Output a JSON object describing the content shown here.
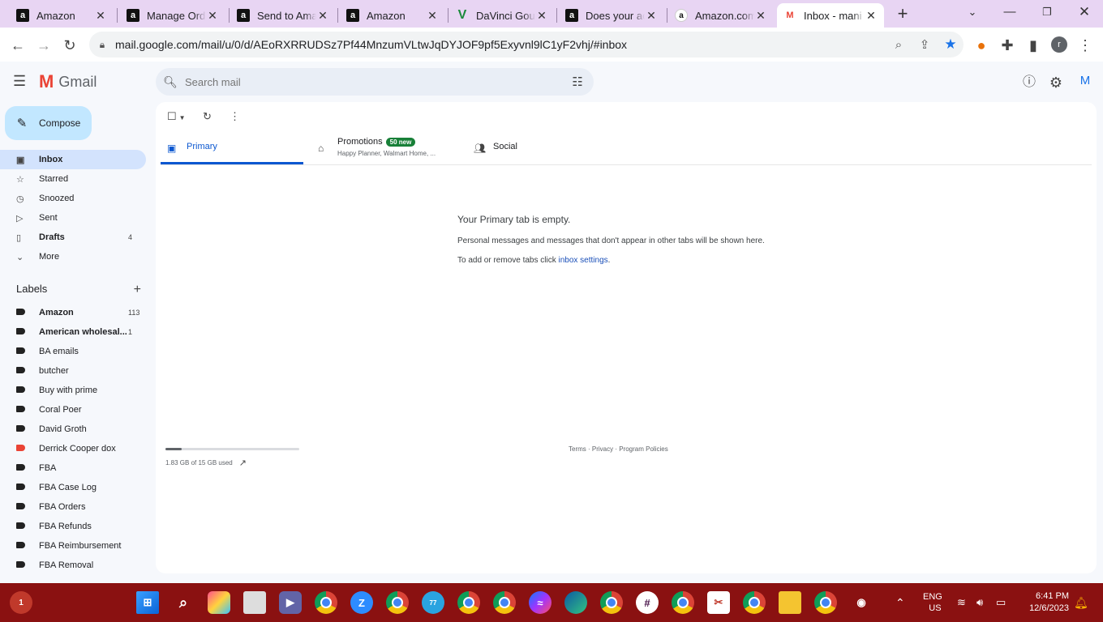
{
  "browser": {
    "tabs": [
      {
        "title": "Amazon",
        "favicon": "amazon-a-icon",
        "active": false
      },
      {
        "title": "Manage Orders",
        "favicon": "amazon-a-icon",
        "active": false
      },
      {
        "title": "Send to Amazon",
        "favicon": "amazon-a-icon",
        "active": false
      },
      {
        "title": "Amazon",
        "favicon": "amazon-a-icon",
        "active": false
      },
      {
        "title": "DaVinci Gourmet",
        "favicon": "davinci-icon",
        "active": false
      },
      {
        "title": "Does your ac",
        "favicon": "amazon-a-icon",
        "active": false
      },
      {
        "title": "Amazon.com",
        "favicon": "amazon-smile-icon",
        "active": false
      },
      {
        "title": "Inbox - mani",
        "favicon": "gmail-icon",
        "active": true
      }
    ],
    "url": "mail.google.com/mail/u/0/d/AEoRXRRUDSz7Pf44MnzumVLtwJqDYJOF9pf5Exyvnl9lC1yF2vhj/#inbox",
    "profile_initial": "r"
  },
  "gmail": {
    "brand": "Gmail",
    "search_placeholder": "Search mail",
    "account_initial": "M",
    "compose_label": "Compose",
    "nav": [
      {
        "label": "Inbox",
        "icon": "inbox-icon",
        "count": "",
        "active": true,
        "bold": true
      },
      {
        "label": "Starred",
        "icon": "star-icon",
        "count": "",
        "active": false,
        "bold": false
      },
      {
        "label": "Snoozed",
        "icon": "clock-icon",
        "count": "",
        "active": false,
        "bold": false
      },
      {
        "label": "Sent",
        "icon": "send-icon",
        "count": "",
        "active": false,
        "bold": false
      },
      {
        "label": "Drafts",
        "icon": "draft-icon",
        "count": "4",
        "active": false,
        "bold": true
      },
      {
        "label": "More",
        "icon": "chevron-down-icon",
        "count": "",
        "active": false,
        "bold": false
      }
    ],
    "labels_title": "Labels",
    "labels": [
      {
        "name": "Amazon",
        "count": "113",
        "bold": true,
        "color": "#202124"
      },
      {
        "name": "American wholesal...",
        "count": "1",
        "bold": true,
        "color": "#202124"
      },
      {
        "name": "BA emails",
        "count": "",
        "bold": false,
        "color": "#202124"
      },
      {
        "name": "butcher",
        "count": "",
        "bold": false,
        "color": "#202124"
      },
      {
        "name": "Buy with prime",
        "count": "",
        "bold": false,
        "color": "#202124"
      },
      {
        "name": "Coral Poer",
        "count": "",
        "bold": false,
        "color": "#202124"
      },
      {
        "name": "David Groth",
        "count": "",
        "bold": false,
        "color": "#202124"
      },
      {
        "name": "Derrick Cooper dox",
        "count": "",
        "bold": false,
        "color": "#ea4335"
      },
      {
        "name": "FBA",
        "count": "",
        "bold": false,
        "color": "#202124"
      },
      {
        "name": "FBA Case Log",
        "count": "",
        "bold": false,
        "color": "#202124"
      },
      {
        "name": "FBA Orders",
        "count": "",
        "bold": false,
        "color": "#202124"
      },
      {
        "name": "FBA Refunds",
        "count": "",
        "bold": false,
        "color": "#202124"
      },
      {
        "name": "FBA Reimbursement",
        "count": "",
        "bold": false,
        "color": "#202124"
      },
      {
        "name": "FBA Removal",
        "count": "",
        "bold": false,
        "color": "#202124"
      }
    ],
    "tabs": [
      {
        "label": "Primary",
        "icon": "inbox-tab-icon",
        "active": true
      },
      {
        "label": "Promotions",
        "icon": "tag-icon",
        "badge": "50 new",
        "snippet": "Happy Planner, Walmart Home, ...",
        "active": false
      },
      {
        "label": "Social",
        "icon": "people-icon",
        "active": false
      }
    ],
    "empty_title": "Your Primary tab is empty.",
    "empty_desc": "Personal messages and messages that don't appear in other tabs will be shown here.",
    "empty_tip_prefix": "To add or remove tabs click ",
    "empty_tip_link": "inbox settings",
    "empty_tip_suffix": ".",
    "storage_text": "1.83 GB of 15 GB used",
    "storage_fraction": 0.122,
    "footer_links": [
      "Terms",
      "Privacy",
      "Program Policies"
    ]
  },
  "taskbar": {
    "notification_count": "1",
    "telegram_count": "77",
    "lang": "ENG",
    "region": "US",
    "time": "6:41 PM",
    "date": "12/6/2023"
  }
}
